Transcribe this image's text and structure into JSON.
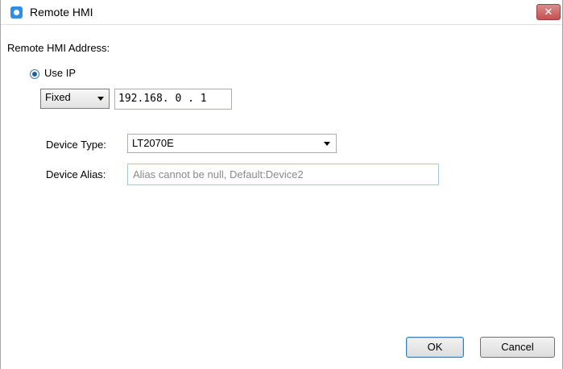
{
  "window": {
    "title": "Remote HMI",
    "close_label": "✕"
  },
  "form": {
    "address_label": "Remote HMI Address:",
    "use_ip_label": "Use IP",
    "ip_mode": "Fixed",
    "ip_address": "192.168. 0 . 1",
    "device_type_label": "Device Type:",
    "device_type_value": "LT2070E",
    "device_alias_label": "Device Alias:",
    "device_alias_placeholder": "Alias cannot be null, Default:Device2"
  },
  "buttons": {
    "ok": "OK",
    "cancel": "Cancel"
  }
}
